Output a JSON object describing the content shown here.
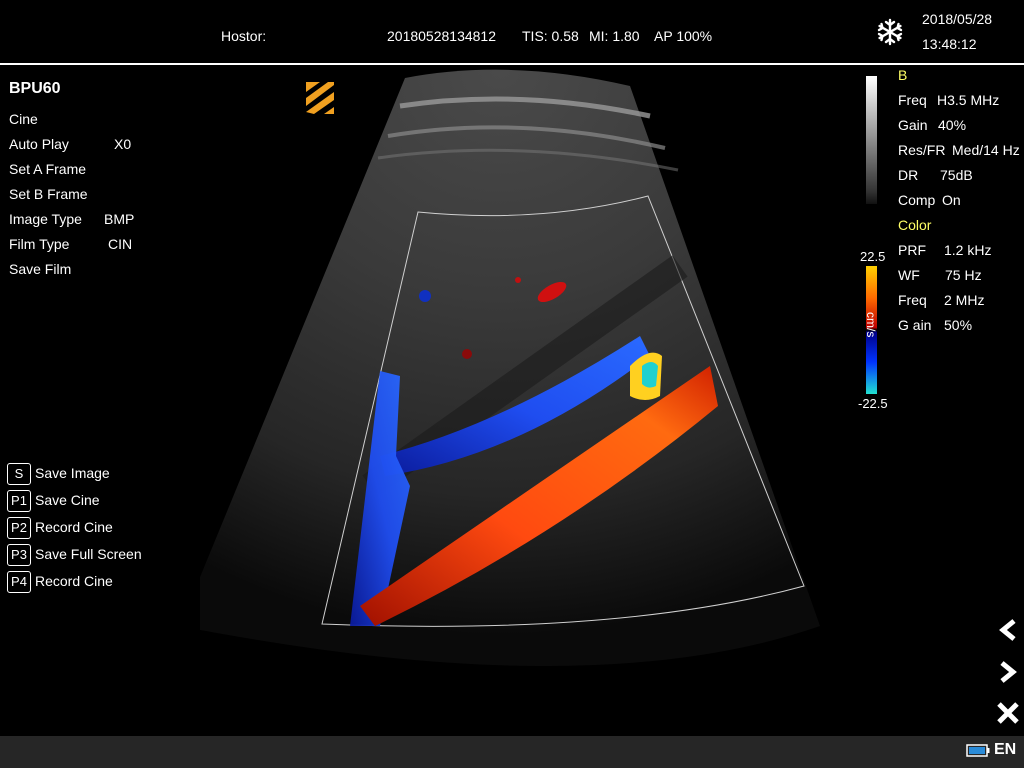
{
  "header": {
    "hospital": "Hostor:",
    "exam_id": "20180528134812",
    "tis": "TIS: 0.58",
    "mi": "MI: 1.80",
    "ap": "AP 100%",
    "date": "2018/05/28",
    "time": "13:48:12",
    "freeze_icon": "snowflake-icon"
  },
  "menu": {
    "title": "BPU60",
    "items": [
      {
        "label": "Cine",
        "value": ""
      },
      {
        "label": "Auto Play",
        "value": "X0"
      },
      {
        "label": "Set A Frame",
        "value": ""
      },
      {
        "label": "Set B Frame",
        "value": ""
      },
      {
        "label": "Image Type",
        "value": "BMP"
      },
      {
        "label": "Film Type",
        "value": "CIN"
      },
      {
        "label": "Save Film",
        "value": ""
      }
    ]
  },
  "shortcuts": [
    {
      "key": "S",
      "label": "Save Image"
    },
    {
      "key": "P1",
      "label": "Save Cine"
    },
    {
      "key": "P2",
      "label": "Record Cine"
    },
    {
      "key": "P3",
      "label": "Save Full Screen"
    },
    {
      "key": "P4",
      "label": "Record Cine"
    }
  ],
  "b_mode": {
    "title": "B",
    "params": [
      {
        "label": "Freq",
        "value": "H3.5 MHz"
      },
      {
        "label": "Gain",
        "value": "40%"
      },
      {
        "label": "Res/FR",
        "value": "Med/14 Hz"
      },
      {
        "label": "DR",
        "value": "75dB"
      },
      {
        "label": "Comp",
        "value": "On"
      }
    ]
  },
  "color_mode": {
    "title": "Color",
    "params": [
      {
        "label": "PRF",
        "value": "1.2 kHz"
      },
      {
        "label": "WF",
        "value": "75 Hz"
      },
      {
        "label": "Freq",
        "value": "2 MHz"
      },
      {
        "label": "G ain",
        "value": "50%"
      }
    ]
  },
  "color_scale": {
    "max": "22.5",
    "min": "-22.5",
    "unit": "cm/s"
  },
  "nav": {
    "prev_icon": "chevron-left-icon",
    "next_icon": "chevron-right-icon",
    "close_icon": "close-icon"
  },
  "status": {
    "language": "EN",
    "battery_icon": "battery-icon"
  },
  "colors": {
    "accent_yellow": "#ffff66",
    "probe_marker": "#f0a020",
    "bottom_bar": "#262626"
  }
}
